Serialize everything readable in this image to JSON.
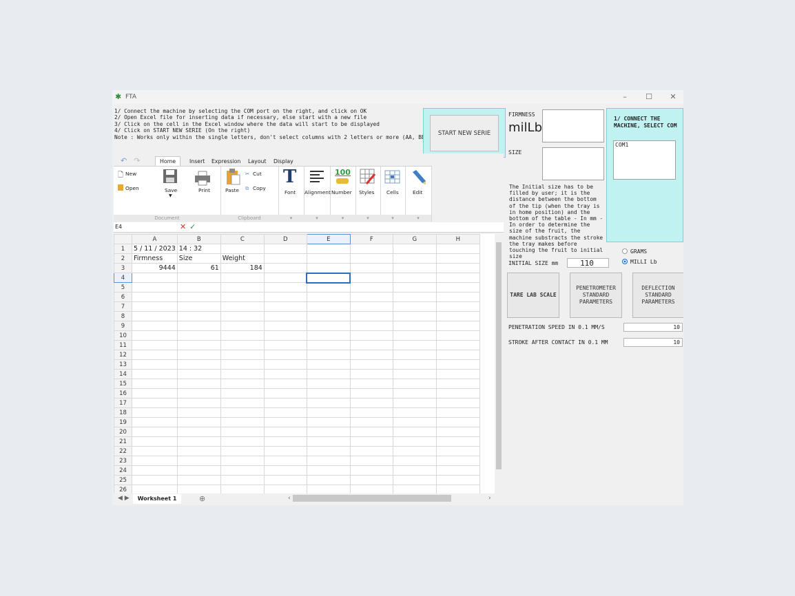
{
  "window": {
    "title": "FTA",
    "min": "–",
    "max": "☐",
    "close": "✕"
  },
  "instructions": [
    "1/ Connect the machine by selecting the COM port on the right, and click on OK",
    "2/ Open Excel file for inserting data if necessary, else start with a new file",
    "3/ Click on the cell in the Excel window where the data will start to be displayed",
    "4/ Click on START NEW SERIE (On the right)",
    "Note : Works only within the single letters, don't select columns with 2 letters or more (AA, BB..)"
  ],
  "start_button": "START NEW SERIE",
  "ribbon": {
    "tabs": [
      "Home",
      "Insert",
      "Expression",
      "Layout",
      "Display"
    ],
    "active_tab": "Home",
    "new": "New",
    "open": "Open",
    "save": "Save",
    "print": "Print",
    "document_group": "Document",
    "paste": "Paste",
    "cut": "Cut",
    "copy": "Copy",
    "clipboard_group": "Clipboard",
    "font": "Font",
    "alignment": "Alignment",
    "number": "Number",
    "styles": "Styles",
    "cells": "Cells",
    "edit": "Edit",
    "number_icon_text": "100"
  },
  "formula": {
    "cell_ref": "E4",
    "cancel": "✕",
    "accept": "✓"
  },
  "sheet": {
    "columns": [
      "A",
      "B",
      "C",
      "D",
      "E",
      "F",
      "G",
      "H"
    ],
    "selected_column": "E",
    "selected_row": "4",
    "rows": [
      {
        "n": "1",
        "cells": [
          "5 / 11 / 2023",
          "14 : 32",
          "",
          "",
          "",
          "",
          "",
          ""
        ]
      },
      {
        "n": "2",
        "cells": [
          "Firmness",
          "Size",
          "Weight",
          "",
          "",
          "",
          "",
          ""
        ]
      },
      {
        "n": "3",
        "cells": [
          "9444",
          "61",
          "184",
          "",
          "",
          "",
          "",
          ""
        ]
      },
      {
        "n": "4",
        "cells": [
          "",
          "",
          "",
          "",
          "",
          "",
          "",
          ""
        ]
      },
      {
        "n": "5",
        "cells": [
          "",
          "",
          "",
          "",
          "",
          "",
          "",
          ""
        ]
      },
      {
        "n": "6",
        "cells": [
          "",
          "",
          "",
          "",
          "",
          "",
          "",
          ""
        ]
      },
      {
        "n": "7",
        "cells": [
          "",
          "",
          "",
          "",
          "",
          "",
          "",
          ""
        ]
      },
      {
        "n": "8",
        "cells": [
          "",
          "",
          "",
          "",
          "",
          "",
          "",
          ""
        ]
      },
      {
        "n": "9",
        "cells": [
          "",
          "",
          "",
          "",
          "",
          "",
          "",
          ""
        ]
      },
      {
        "n": "10",
        "cells": [
          "",
          "",
          "",
          "",
          "",
          "",
          "",
          ""
        ]
      },
      {
        "n": "11",
        "cells": [
          "",
          "",
          "",
          "",
          "",
          "",
          "",
          ""
        ]
      },
      {
        "n": "12",
        "cells": [
          "",
          "",
          "",
          "",
          "",
          "",
          "",
          ""
        ]
      },
      {
        "n": "13",
        "cells": [
          "",
          "",
          "",
          "",
          "",
          "",
          "",
          ""
        ]
      },
      {
        "n": "14",
        "cells": [
          "",
          "",
          "",
          "",
          "",
          "",
          "",
          ""
        ]
      },
      {
        "n": "15",
        "cells": [
          "",
          "",
          "",
          "",
          "",
          "",
          "",
          ""
        ]
      },
      {
        "n": "16",
        "cells": [
          "",
          "",
          "",
          "",
          "",
          "",
          "",
          ""
        ]
      },
      {
        "n": "17",
        "cells": [
          "",
          "",
          "",
          "",
          "",
          "",
          "",
          ""
        ]
      },
      {
        "n": "18",
        "cells": [
          "",
          "",
          "",
          "",
          "",
          "",
          "",
          ""
        ]
      },
      {
        "n": "19",
        "cells": [
          "",
          "",
          "",
          "",
          "",
          "",
          "",
          ""
        ]
      },
      {
        "n": "20",
        "cells": [
          "",
          "",
          "",
          "",
          "",
          "",
          "",
          ""
        ]
      },
      {
        "n": "21",
        "cells": [
          "",
          "",
          "",
          "",
          "",
          "",
          "",
          ""
        ]
      },
      {
        "n": "22",
        "cells": [
          "",
          "",
          "",
          "",
          "",
          "",
          "",
          ""
        ]
      },
      {
        "n": "23",
        "cells": [
          "",
          "",
          "",
          "",
          "",
          "",
          "",
          ""
        ]
      },
      {
        "n": "24",
        "cells": [
          "",
          "",
          "",
          "",
          "",
          "",
          "",
          ""
        ]
      },
      {
        "n": "25",
        "cells": [
          "",
          "",
          "",
          "",
          "",
          "",
          "",
          ""
        ]
      },
      {
        "n": "26",
        "cells": [
          "",
          "",
          "",
          "",
          "",
          "",
          "",
          ""
        ]
      }
    ],
    "sheet_tab": "Worksheet 1",
    "add_sheet": "⊕"
  },
  "panel": {
    "firmness_label": "FIRMNESS",
    "firmness_unit": "milLb",
    "size_label": "SIZE",
    "note": "The Initial size has to be filled by user; it is the distance between the bottom of the tip (when the tray is in home position) and the bottom of the table - In mm - In order to determine the size of the fruit, the machine substracts the stroke the tray makes before touching the fruit to initial size",
    "connect_title": "1/ CONNECT THE MACHINE, SELECT COM",
    "com_ports": [
      "COM1"
    ],
    "unit_grams": "GRAMS",
    "unit_millilb": "MILLI Lb",
    "unit_selected": "MILLI Lb",
    "initial_size_label": "INITIAL SIZE mm",
    "initial_size_value": "110",
    "tare_button": "TARE LAB SCALE",
    "penetrometer_button": "PENETROMETER STANDARD PARAMETERS",
    "deflection_button": "DEFLECTION STANDARD PARAMETERS",
    "speed_label": "PENETRATION SPEED IN 0.1 MM/S",
    "speed_value": "10",
    "stroke_label": "STROKE AFTER CONTACT IN 0.1 MM",
    "stroke_value": "10"
  },
  "colors": {
    "accent_panel": "#c0f2f2",
    "selection": "#2a6ec1",
    "cancel": "#d9302c",
    "accept": "#2e9c3a"
  }
}
